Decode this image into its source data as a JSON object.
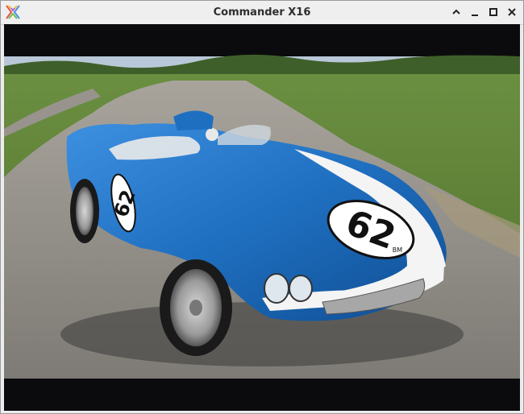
{
  "window": {
    "title": "Commander X16",
    "icon": "x16-logo-icon",
    "controls": [
      "chevron-up-icon",
      "minimize-icon",
      "maximize-icon",
      "close-icon"
    ]
  },
  "screen": {
    "image_subject": "car-photo",
    "car_number": "62",
    "plate_text": "BM",
    "colors": {
      "letterbox": "#0b0b0d",
      "car_body": "#1f6fc0",
      "stripe": "#f4f4f4",
      "grass": "#5f7f3a",
      "road": "#8f8c86",
      "sky": "#b9c8d8"
    }
  }
}
